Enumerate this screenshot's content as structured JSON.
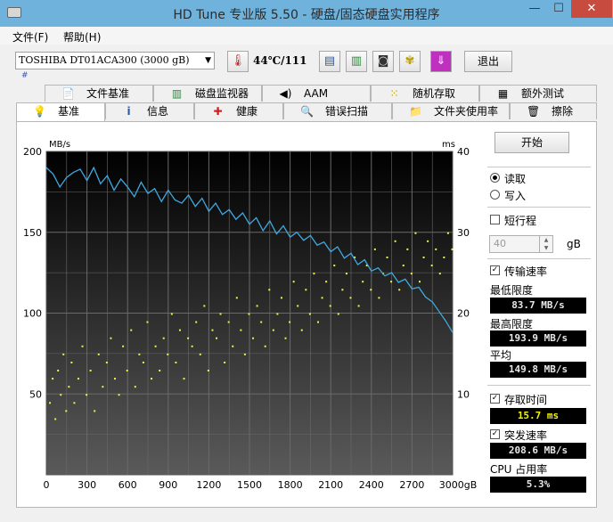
{
  "window": {
    "title": "HD Tune 专业版 5.50 - 硬盘/固态硬盘实用程序",
    "minimize": "—",
    "maximize": "☐",
    "close": "✕"
  },
  "menu": [
    {
      "label": "文件(F)"
    },
    {
      "label": "帮助(H)"
    }
  ],
  "toolbar": {
    "drive": "TOSHIBA DT01ACA300 (3000 gB)",
    "drive_sub": "#",
    "temperature": "44℃/111",
    "exit_label": "退出"
  },
  "tabs_top": [
    {
      "label": "文件基准",
      "icon": "file-icon"
    },
    {
      "label": "磁盘监视器",
      "icon": "monitor-icon"
    },
    {
      "label": "AAM",
      "icon": "speaker-icon"
    },
    {
      "label": "随机存取",
      "icon": "dice-icon"
    },
    {
      "label": "额外测试",
      "icon": "calculator-icon"
    }
  ],
  "tabs_bottom": [
    {
      "label": "基准",
      "icon": "lightbulb-icon",
      "active": true
    },
    {
      "label": "信息",
      "icon": "info-icon"
    },
    {
      "label": "健康",
      "icon": "health-cross-icon"
    },
    {
      "label": "错误扫描",
      "icon": "magnifier-icon"
    },
    {
      "label": "文件夹使用率",
      "icon": "folder-icon"
    },
    {
      "label": "擦除",
      "icon": "trash-icon"
    }
  ],
  "controls": {
    "start_label": "开始",
    "read_label": "读取",
    "write_label": "写入",
    "mode": "read",
    "short_stroke_label": "短行程",
    "short_stroke_checked": false,
    "short_stroke_value": "40",
    "short_stroke_unit": "gB",
    "transfer_label": "传输速率",
    "transfer_checked": true,
    "min_label": "最低限度",
    "min_value": "83.7 MB/s",
    "max_label": "最高限度",
    "max_value": "193.9 MB/s",
    "avg_label": "平均",
    "avg_value": "149.8 MB/s",
    "access_label": "存取时间",
    "access_checked": true,
    "access_value": "15.7 ms",
    "burst_label": "突发速率",
    "burst_checked": true,
    "burst_value": "208.6 MB/s",
    "cpu_label": "CPU 占用率",
    "cpu_value": "5.3%"
  },
  "chart_data": {
    "type": "line",
    "left_axis_label": "MB/s",
    "right_axis_label": "ms",
    "x_ticks": [
      "0",
      "300",
      "600",
      "900",
      "1200",
      "1500",
      "1800",
      "2100",
      "2400",
      "2700",
      "3000gB"
    ],
    "y_left_ticks": [
      "200",
      "150",
      "100",
      "50"
    ],
    "y_right_ticks": [
      "40",
      "30",
      "20",
      "10"
    ],
    "xlim": [
      0,
      3000
    ],
    "ylim_left": [
      0,
      200
    ],
    "ylim_right": [
      0,
      40
    ],
    "grid": true,
    "colors": {
      "transfer": "#3fa9e0",
      "access": "#f0f04a",
      "background_top": "#000000",
      "background_bottom": "#5a5a5a",
      "grid": "#6a6a6a"
    },
    "series": [
      {
        "name": "传输速率",
        "axis": "left",
        "x": [
          0,
          50,
          100,
          150,
          200,
          250,
          300,
          350,
          400,
          450,
          500,
          550,
          600,
          650,
          700,
          750,
          800,
          850,
          900,
          950,
          1000,
          1050,
          1100,
          1150,
          1200,
          1250,
          1300,
          1350,
          1400,
          1450,
          1500,
          1550,
          1600,
          1650,
          1700,
          1750,
          1800,
          1850,
          1900,
          1950,
          2000,
          2050,
          2100,
          2150,
          2200,
          2250,
          2300,
          2350,
          2400,
          2450,
          2500,
          2550,
          2600,
          2650,
          2700,
          2750,
          2800,
          2850,
          2900,
          2950,
          3000
        ],
        "y": [
          190,
          186,
          178,
          184,
          187,
          189,
          182,
          190,
          180,
          185,
          176,
          183,
          178,
          172,
          181,
          174,
          177,
          169,
          176,
          170,
          168,
          173,
          166,
          171,
          163,
          168,
          161,
          164,
          158,
          162,
          155,
          159,
          151,
          157,
          149,
          154,
          147,
          150,
          145,
          148,
          142,
          144,
          138,
          141,
          134,
          137,
          130,
          133,
          126,
          128,
          123,
          125,
          119,
          121,
          115,
          116,
          110,
          107,
          101,
          95,
          88
        ]
      },
      {
        "name": "存取时间",
        "axis": "right",
        "x": [
          20,
          40,
          60,
          80,
          100,
          120,
          140,
          160,
          180,
          200,
          230,
          260,
          290,
          320,
          350,
          380,
          410,
          440,
          470,
          500,
          530,
          560,
          590,
          620,
          650,
          680,
          710,
          740,
          770,
          800,
          830,
          860,
          890,
          920,
          950,
          980,
          1010,
          1040,
          1070,
          1100,
          1130,
          1160,
          1190,
          1220,
          1250,
          1280,
          1310,
          1340,
          1370,
          1400,
          1430,
          1460,
          1490,
          1520,
          1550,
          1580,
          1610,
          1640,
          1670,
          1700,
          1730,
          1760,
          1790,
          1820,
          1850,
          1880,
          1910,
          1940,
          1970,
          2000,
          2030,
          2060,
          2090,
          2120,
          2150,
          2180,
          2210,
          2240,
          2270,
          2300,
          2330,
          2360,
          2390,
          2420,
          2450,
          2480,
          2510,
          2540,
          2570,
          2600,
          2630,
          2660,
          2690,
          2720,
          2750,
          2780,
          2810,
          2840,
          2870,
          2900,
          2930,
          2960,
          2990
        ],
        "y": [
          9,
          12,
          7,
          13,
          10,
          15,
          8,
          11,
          14,
          9,
          12,
          16,
          10,
          13,
          8,
          15,
          11,
          14,
          17,
          12,
          10,
          16,
          13,
          18,
          11,
          15,
          14,
          19,
          12,
          16,
          13,
          17,
          15,
          20,
          14,
          18,
          12,
          17,
          16,
          19,
          15,
          21,
          13,
          18,
          17,
          20,
          14,
          19,
          16,
          22,
          18,
          15,
          20,
          17,
          21,
          19,
          16,
          23,
          18,
          20,
          22,
          17,
          19,
          24,
          21,
          18,
          23,
          20,
          25,
          19,
          22,
          24,
          21,
          26,
          20,
          23,
          25,
          22,
          27,
          21,
          24,
          26,
          23,
          28,
          22,
          25,
          27,
          24,
          29,
          23,
          26,
          28,
          25,
          30,
          24,
          27,
          29,
          26,
          28,
          25,
          27,
          30,
          28
        ]
      }
    ]
  }
}
